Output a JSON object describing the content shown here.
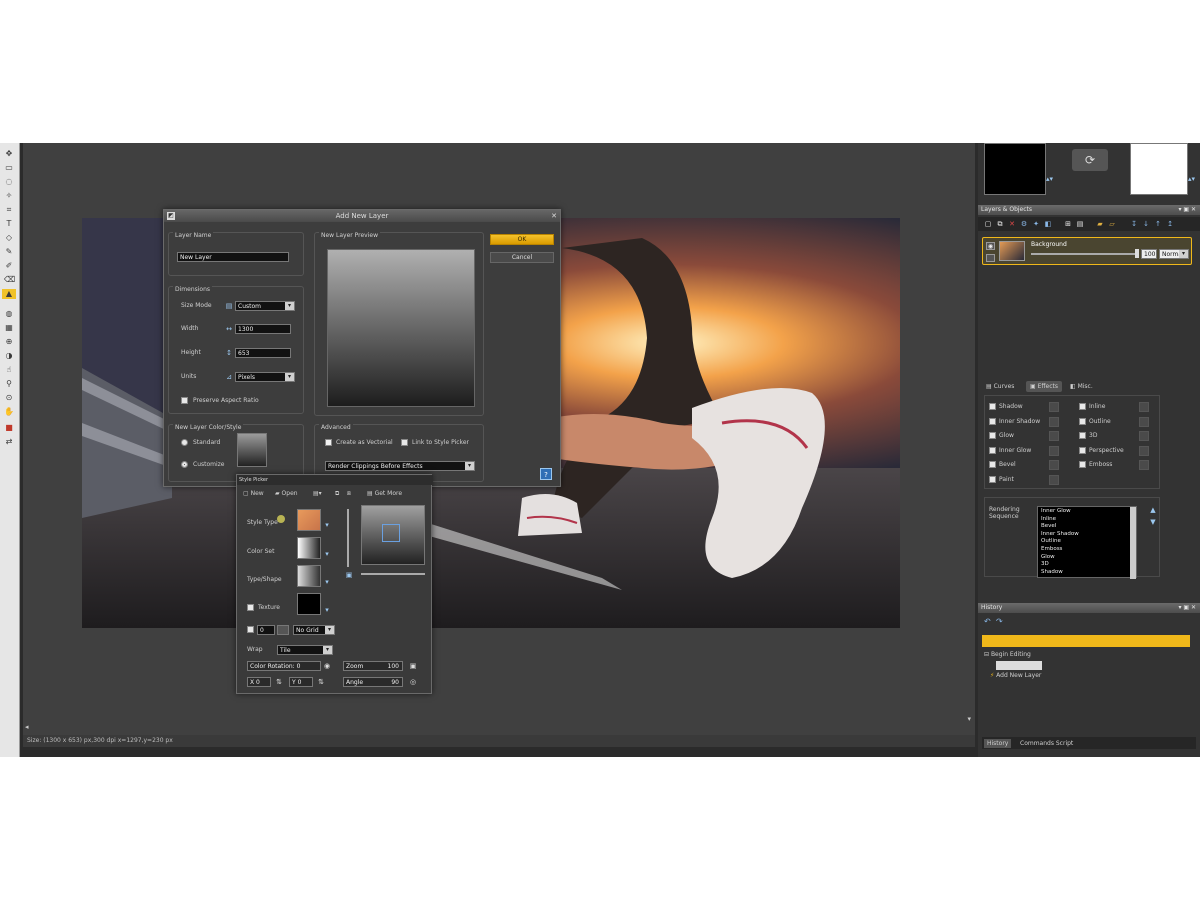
{
  "status_bar": {
    "text": "Size: (1300 x 653) px,300 dpi   x=1297,y=230 px"
  },
  "add_layer_dialog": {
    "title": "Add New Layer",
    "layer_name_group": "Layer Name",
    "layer_name_value": "New Layer",
    "dimensions_group": "Dimensions",
    "size_mode_label": "Size Mode",
    "size_mode_value": "Custom",
    "width_label": "Width",
    "width_value": "1300",
    "height_label": "Height",
    "height_value": "653",
    "units_label": "Units",
    "units_value": "Pixels",
    "preserve_label": "Preserve Aspect Ratio",
    "color_style_group": "New Layer Color/Style",
    "standard_label": "Standard",
    "customize_label": "Customize",
    "preview_group": "New Layer Preview",
    "ok_label": "OK",
    "cancel_label": "Cancel",
    "advanced_group": "Advanced",
    "vectorial_label": "Create as Vectorial",
    "link_style_label": "Link to Style Picker",
    "render_value": "Render Clippings Before Effects",
    "help_label": "?"
  },
  "style_picker": {
    "title": "Style Picker",
    "new_label": "New",
    "open_label": "Open",
    "get_more_label": "Get More",
    "style_type_label": "Style Type",
    "color_set_label": "Color Set",
    "type_shape_label": "Type/Shape",
    "texture_label": "Texture",
    "grid_num_value": "0",
    "grid_value": "No Grid",
    "wrap_label": "Wrap",
    "wrap_value": "Tile",
    "color_rotation_label": "Color Rotation",
    "color_rotation_value": "0",
    "zoom_label": "Zoom",
    "zoom_value": "100",
    "x_label": "X",
    "x_value": "0",
    "y_label": "Y",
    "y_value": "0",
    "angle_label": "Angle",
    "angle_value": "90",
    "colors": {
      "style_swatch": "#e89a5c"
    }
  },
  "layers_panel": {
    "title": "Layers & Objects",
    "layer_name": "Background",
    "opacity_value": "100",
    "blend_value": "Normal"
  },
  "effects_panel": {
    "tabs": [
      "Curves",
      "Effects",
      "Misc."
    ],
    "left_effects": [
      "Shadow",
      "Inner Shadow",
      "Glow",
      "Inner Glow",
      "Bevel",
      "Paint"
    ],
    "right_effects": [
      "Inline",
      "Outline",
      "3D",
      "Perspective",
      "Emboss"
    ],
    "rendering_label": "Rendering Sequence",
    "rendering_list": [
      "Inner Glow",
      "Inline",
      "Bevel",
      "Inner Shadow",
      "Outline",
      "Emboss",
      "Glow",
      "3D",
      "Shadow"
    ]
  },
  "history_panel": {
    "title": "History",
    "items": [
      "Begin Editing",
      "Add New Layer"
    ]
  },
  "bottom_tabs": [
    "History",
    "Commands Script"
  ],
  "accent_color": "#f0b81a"
}
